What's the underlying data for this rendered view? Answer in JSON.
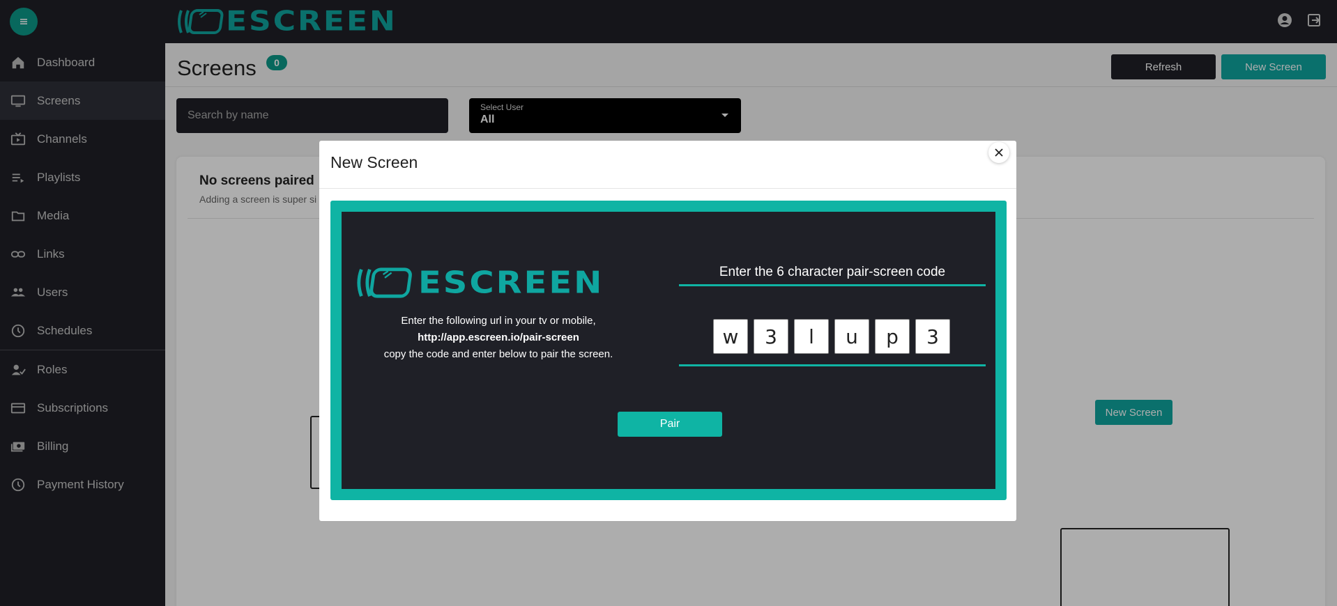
{
  "brand": {
    "name": "ESCREEN"
  },
  "topbar": {
    "menu_icon": "hamburger-icon",
    "account_icon": "account-circle-icon",
    "logout_icon": "logout-icon"
  },
  "sidebar": {
    "items": [
      {
        "label": "Dashboard",
        "icon": "home-icon"
      },
      {
        "label": "Screens",
        "icon": "monitor-icon",
        "active": true
      },
      {
        "label": "Channels",
        "icon": "live-tv-icon"
      },
      {
        "label": "Playlists",
        "icon": "playlist-icon"
      },
      {
        "label": "Media",
        "icon": "folder-icon"
      },
      {
        "label": "Links",
        "icon": "link-icon"
      },
      {
        "label": "Users",
        "icon": "users-icon"
      },
      {
        "label": "Schedules",
        "icon": "clock-icon"
      },
      {
        "label": "Roles",
        "icon": "user-role-icon"
      },
      {
        "label": "Subscriptions",
        "icon": "card-icon"
      },
      {
        "label": "Billing",
        "icon": "billing-icon"
      },
      {
        "label": "Payment History",
        "icon": "history-icon"
      }
    ]
  },
  "header": {
    "title": "Screens",
    "count": "0",
    "refresh_label": "Refresh",
    "new_screen_label": "New Screen"
  },
  "filters": {
    "search_placeholder": "Search by name",
    "user_select_label": "Select User",
    "user_select_value": "All"
  },
  "content": {
    "empty_title": "No screens paired",
    "empty_subtitle": "Adding a screen is super si",
    "new_screen_label": "New Screen"
  },
  "modal": {
    "title": "New Screen",
    "instruction_line1": "Enter the following url in your tv or mobile,",
    "url": "http://app.escreen.io/pair-screen",
    "instruction_line2": "copy the code and enter below to pair the screen.",
    "code_heading": "Enter the 6 character pair-screen code",
    "code": [
      "w",
      "3",
      "l",
      "u",
      "p",
      "3"
    ],
    "pair_label": "Pair"
  },
  "colors": {
    "accent": "#0fa6a0",
    "dark": "#1f2027",
    "frame": "#0fb4a4"
  }
}
